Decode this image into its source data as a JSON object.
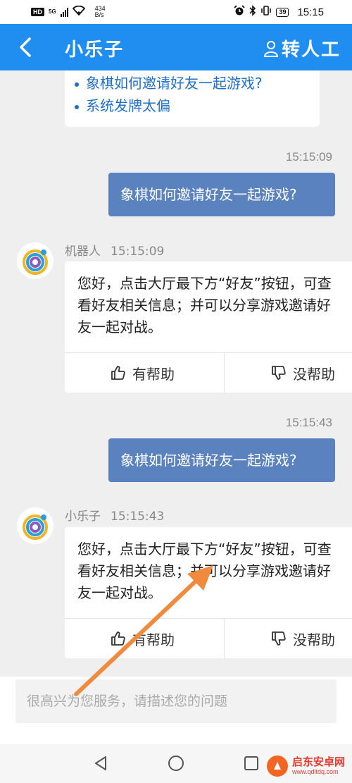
{
  "status_bar": {
    "hd": "HD",
    "network": "5G",
    "speed_value": "434",
    "speed_unit": "B/s",
    "battery": "39",
    "time": "15:15"
  },
  "header": {
    "title": "小乐子",
    "transfer_label": "转人工"
  },
  "faq": {
    "items": [
      "象棋如何邀请好友一起游戏?",
      "系统发牌太偏"
    ]
  },
  "messages": [
    {
      "type": "user",
      "time": "15:15:09",
      "text": "象棋如何邀请好友一起游戏?"
    },
    {
      "type": "bot",
      "sender": "机器人",
      "time": "15:15:09",
      "text": "您好，点击大厅最下方“好友”按钮，可查\n看好友相关信息；并可以分享游戏邀请好\n友一起对战。",
      "helpful_label": "有帮助",
      "not_helpful_label": "没帮助"
    },
    {
      "type": "user",
      "time": "15:15:43",
      "text": "象棋如何邀请好友一起游戏?"
    },
    {
      "type": "bot",
      "sender": "小乐子",
      "time": "15:15:43",
      "text": "您好，点击大厅最下方“好友”按钮，可查\n看好友相关信息；并可以分享游戏邀请好\n友一起对战。",
      "helpful_label": "有帮助",
      "not_helpful_label": "没帮助"
    }
  ],
  "input": {
    "placeholder": "很高兴为您服务，请描述您的问题"
  },
  "colors": {
    "header_bg": "#1f8ef0",
    "user_bubble": "#5a82bf",
    "link": "#1e6fc8",
    "annotation_arrow": "#f08a3c"
  },
  "watermark": {
    "name": "启东安卓网",
    "url": "www.qdltdq.com"
  }
}
